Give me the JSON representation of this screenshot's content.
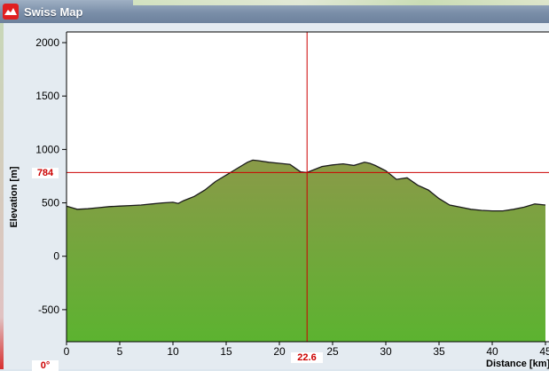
{
  "window": {
    "title": "Swiss Map",
    "icon": "swiss-map-app-icon"
  },
  "chart_data": {
    "type": "area",
    "ylabel": "Elevation [m]",
    "xlabel": "Distance [km]",
    "xlim": [
      0,
      45
    ],
    "ylim": [
      -800,
      2100
    ],
    "xticks": [
      0,
      5,
      10,
      15,
      20,
      25,
      30,
      35,
      40,
      45
    ],
    "yticks": [
      -500,
      0,
      500,
      1000,
      1500,
      2000
    ],
    "x": [
      0,
      0.5,
      1,
      2,
      3,
      4,
      5,
      6,
      7,
      8,
      9,
      10,
      10.5,
      11,
      12,
      13,
      14,
      15,
      16,
      17,
      17.5,
      18,
      19,
      20,
      21,
      22,
      22.6,
      23,
      24,
      25,
      26,
      27,
      28,
      28.5,
      29,
      30,
      31,
      32,
      33,
      34,
      35,
      36,
      37,
      38,
      39,
      40,
      41,
      42,
      43,
      44,
      45
    ],
    "y": [
      470,
      455,
      440,
      445,
      455,
      465,
      470,
      475,
      480,
      490,
      500,
      505,
      495,
      520,
      560,
      620,
      700,
      760,
      820,
      880,
      900,
      895,
      880,
      870,
      860,
      790,
      784,
      800,
      840,
      855,
      865,
      850,
      880,
      870,
      850,
      800,
      720,
      735,
      665,
      620,
      540,
      480,
      460,
      440,
      430,
      425,
      425,
      440,
      460,
      490,
      480
    ],
    "crosshair": {
      "x": 22.6,
      "y": 784
    },
    "fill": [
      "#8a9a48",
      "#5cb330"
    ],
    "crosshair_color": "#cc0000"
  },
  "readouts": {
    "elevation_value": "784",
    "distance_value": "22.6",
    "angle_value": "0°"
  }
}
